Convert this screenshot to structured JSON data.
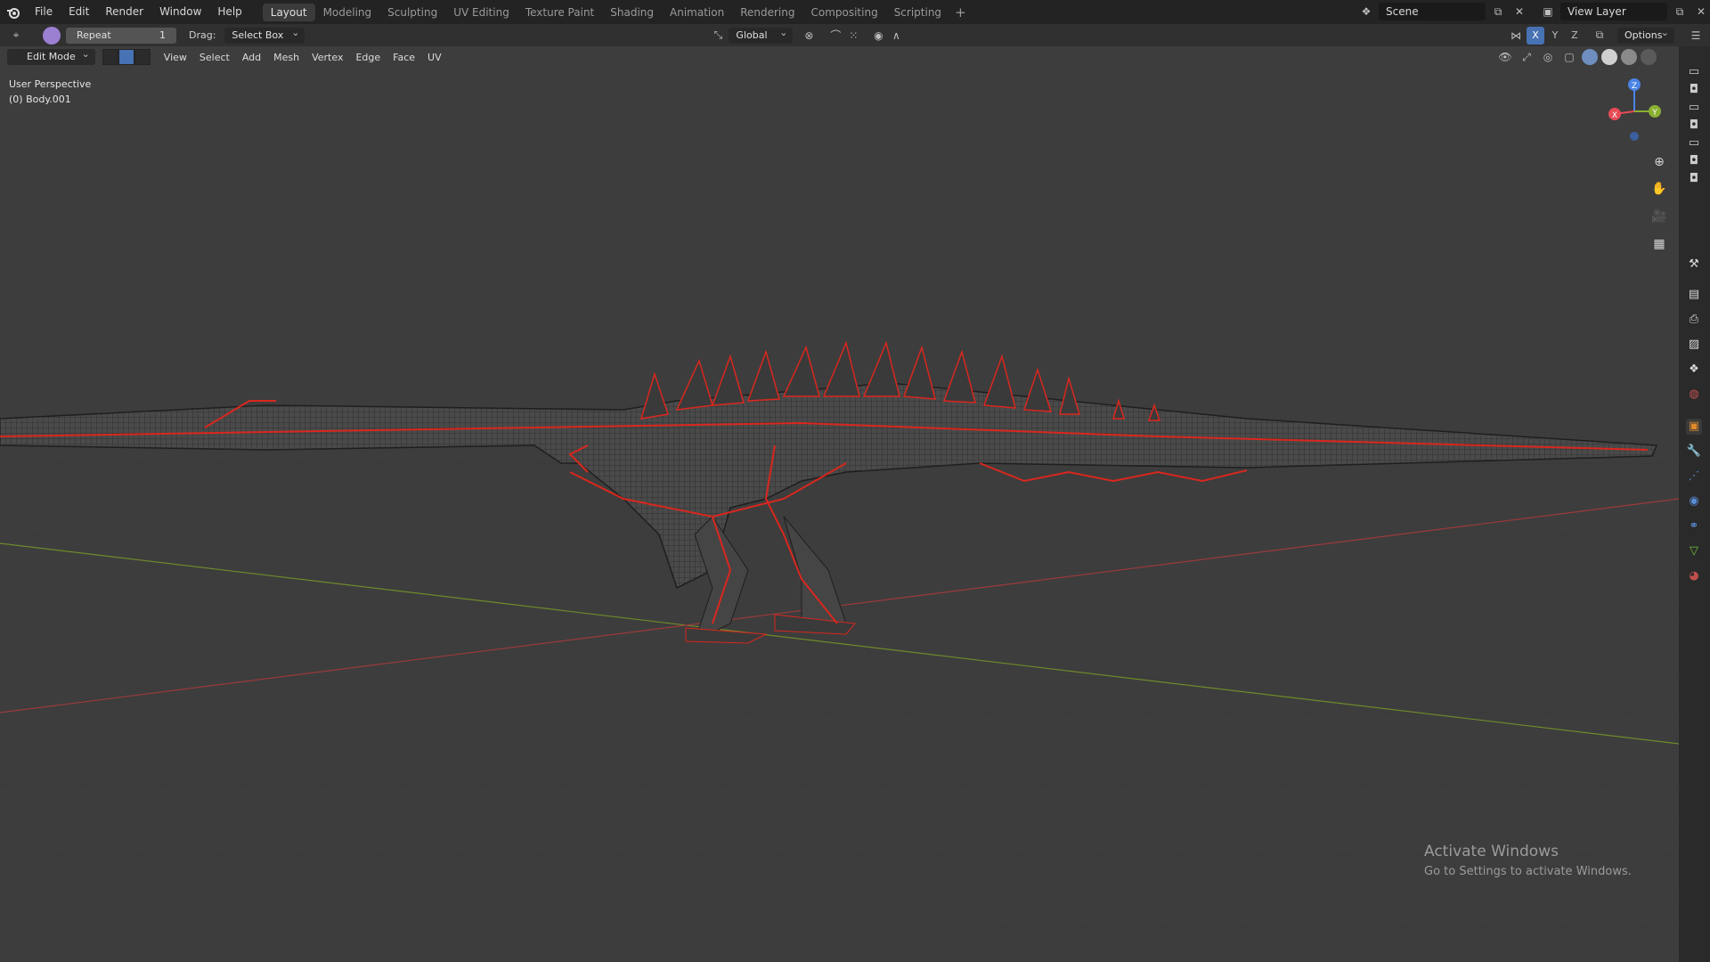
{
  "topbar": {
    "menu": [
      "File",
      "Edit",
      "Render",
      "Window",
      "Help"
    ],
    "workspaces": [
      "Layout",
      "Modeling",
      "Sculpting",
      "UV Editing",
      "Texture Paint",
      "Shading",
      "Animation",
      "Rendering",
      "Compositing",
      "Scripting"
    ],
    "active_workspace": "Layout",
    "add_label": "+",
    "scene_name": "Scene",
    "view_layer": "View Layer"
  },
  "toolbar": {
    "repeat_label": "Repeat",
    "repeat_count": "1",
    "drag_label": "Drag:",
    "drag_value": "Select Box",
    "orientation": "Global",
    "options_label": "Options",
    "axes": [
      "X",
      "Y",
      "Z"
    ]
  },
  "viewport": {
    "mode": "Edit Mode",
    "menus": [
      "View",
      "Select",
      "Add",
      "Mesh",
      "Vertex",
      "Edge",
      "Face",
      "UV"
    ],
    "perspective": "User Perspective",
    "object": "(0) Body.001",
    "gizmo": {
      "x": "X",
      "y": "Y",
      "z": "Z"
    }
  },
  "activate_windows": {
    "title": "Activate Windows",
    "subtitle": "Go to Settings to activate Windows."
  },
  "colors": {
    "accent": "#4772b3",
    "wire": "#2a2a2a",
    "seam": "#d9271e",
    "grid_x": "#9c3a3a",
    "grid_y": "#6f8a2a"
  },
  "icons": {
    "logo": "blender-logo-icon",
    "zoom": "zoom-icon",
    "pan": "hand-icon",
    "camera": "camera-icon",
    "ortho": "grid-icon"
  }
}
